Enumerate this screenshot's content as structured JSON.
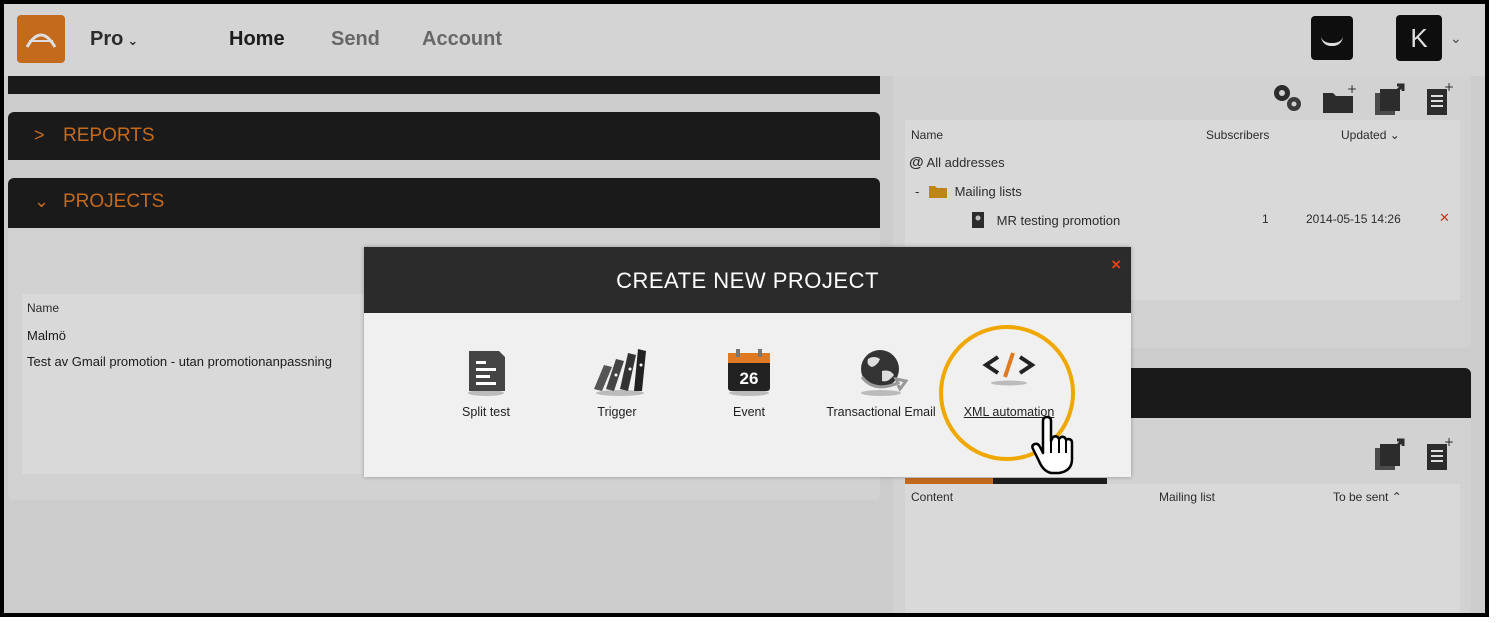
{
  "header": {
    "plan_label": "Pro",
    "nav": [
      "Home",
      "Send",
      "Account"
    ],
    "avatar_letter": "K"
  },
  "left": {
    "reports_label": "REPORTS",
    "projects_label": "PROJECTS",
    "projects_table": {
      "column": "Name",
      "rows": [
        "Malmö",
        "Test av Gmail promotion - utan promotionanpassning"
      ]
    }
  },
  "right": {
    "list_table": {
      "columns": [
        "Name",
        "Subscribers",
        "Updated"
      ],
      "all_addresses": "All addresses",
      "mailing_lists_label": "Mailing lists",
      "collapse_marker": "-",
      "rows": [
        {
          "name": "MR testing promotion",
          "subscribers": "1",
          "updated": "2014-05-15 14:26"
        }
      ]
    },
    "send_table": {
      "columns": [
        "Content",
        "Mailing list",
        "To be sent"
      ]
    }
  },
  "modal": {
    "title": "CREATE NEW PROJECT",
    "close_label": "×",
    "options": [
      {
        "label": "Split test",
        "icon": "split-test-icon"
      },
      {
        "label": "Trigger",
        "icon": "trigger-dominoes-icon"
      },
      {
        "label": "Event",
        "icon": "calendar-icon",
        "day": "26"
      },
      {
        "label": "Transactional Email",
        "icon": "globe-arrow-icon"
      },
      {
        "label": "XML automation",
        "icon": "code-brackets-icon"
      }
    ]
  },
  "colors": {
    "accent": "#e07a22",
    "highlight": "#f0a800",
    "close": "#e0441a",
    "dark_bar": "#1e1e1e"
  }
}
